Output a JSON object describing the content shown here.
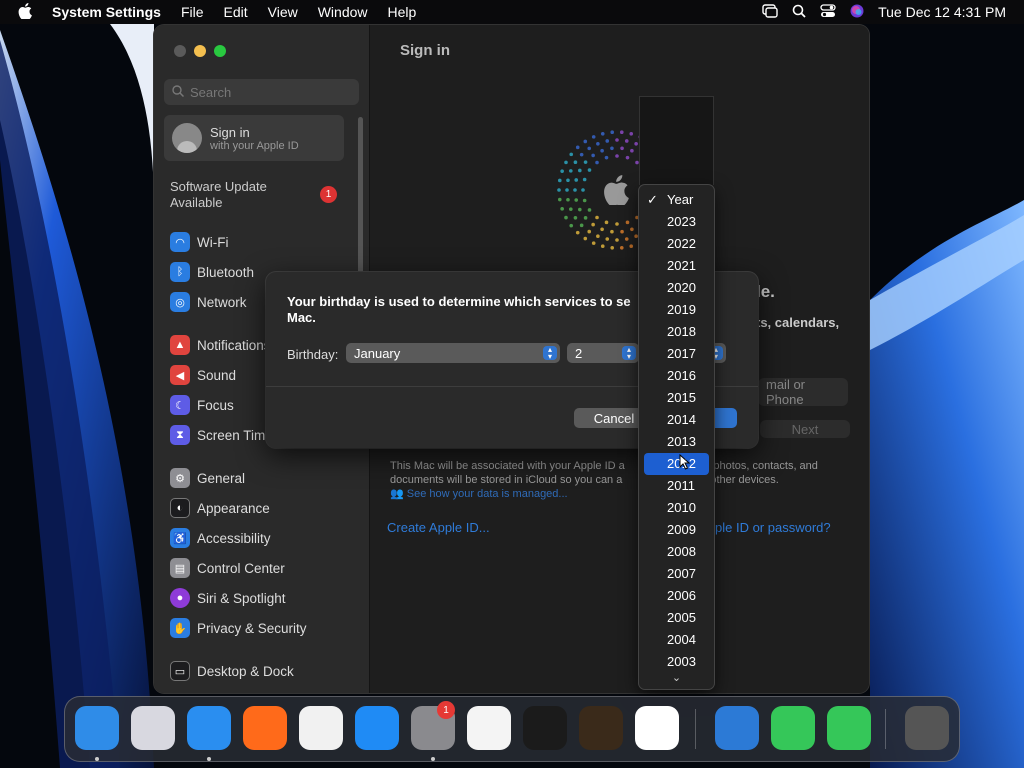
{
  "menubar": {
    "apple_icon": "apple-logo-icon",
    "app_name": "System Settings",
    "menus": [
      "File",
      "Edit",
      "View",
      "Window",
      "Help"
    ],
    "datetime": "Tue Dec 12  4:31 PM"
  },
  "sidebar": {
    "search_placeholder": "Search",
    "signin": {
      "title": "Sign in",
      "subtitle": "with your Apple ID"
    },
    "software_update": {
      "line1": "Software Update",
      "line2": "Available",
      "badge": "1"
    },
    "items": [
      {
        "label": "Wi-Fi",
        "icon": "wifi-icon",
        "color": "#2a7de1"
      },
      {
        "label": "Bluetooth",
        "icon": "bluetooth-icon",
        "color": "#2a7de1"
      },
      {
        "label": "Network",
        "icon": "globe-icon",
        "color": "#2a7de1"
      },
      {
        "label": "Notifications",
        "icon": "bell-icon",
        "color": "#e0443e"
      },
      {
        "label": "Sound",
        "icon": "speaker-icon",
        "color": "#e0443e"
      },
      {
        "label": "Focus",
        "icon": "moon-icon",
        "color": "#5e5ce6"
      },
      {
        "label": "Screen Time",
        "icon": "hourglass-icon",
        "color": "#5e5ce6"
      },
      {
        "label": "General",
        "icon": "gear-icon",
        "color": "#8e8e93"
      },
      {
        "label": "Appearance",
        "icon": "appearance-icon",
        "color": "#1c1c1e"
      },
      {
        "label": "Accessibility",
        "icon": "accessibility-icon",
        "color": "#2a7de1"
      },
      {
        "label": "Control Center",
        "icon": "control-center-icon",
        "color": "#8e8e93"
      },
      {
        "label": "Siri & Spotlight",
        "icon": "siri-icon",
        "color": "#8e3bd8"
      },
      {
        "label": "Privacy & Security",
        "icon": "hand-icon",
        "color": "#2a7de1"
      },
      {
        "label": "Desktop & Dock",
        "icon": "dock-icon",
        "color": "#1c1c1e"
      }
    ]
  },
  "main": {
    "title": "Sign in",
    "heading_fragment": "le.",
    "sub_fragment": "ts, calendars,",
    "email_placeholder": "mail or Phone",
    "next_label": "Next",
    "info_line1": "This Mac will be associated with your Apple ID a",
    "info_line1b": "s photos, contacts, and",
    "info_line2": "documents will be stored in iCloud so you can a",
    "info_line2b": "other devices.",
    "info_line3": "See how your data is managed...",
    "create_link": "Create Apple ID...",
    "forgot_link": "ple ID or password?"
  },
  "dialog": {
    "message": "Your birthday is used to determine which services to se Mac.",
    "birthday_label": "Birthday:",
    "month_value": "January",
    "day_value": "2",
    "cancel_label": "Cancel"
  },
  "year_menu": {
    "checked": "Year",
    "selected": "2012",
    "options": [
      "2023",
      "2022",
      "2021",
      "2020",
      "2019",
      "2018",
      "2017",
      "2016",
      "2015",
      "2014",
      "2013",
      "2012",
      "2011",
      "2010",
      "2009",
      "2008",
      "2007",
      "2006",
      "2005",
      "2004",
      "2003"
    ],
    "more_icon": "chevron-down-icon"
  },
  "dock": {
    "apps": [
      {
        "name": "Finder",
        "icon": "finder-icon",
        "color": "#2f8ce8",
        "running": true
      },
      {
        "name": "Launchpad",
        "icon": "launchpad-icon",
        "color": "#d8d8e0",
        "running": false
      },
      {
        "name": "Safari",
        "icon": "safari-icon",
        "color": "#2a8ef0",
        "running": true
      },
      {
        "name": "Firefox",
        "icon": "firefox-icon",
        "color": "#ff6a1a",
        "running": false
      },
      {
        "name": "Chrome",
        "icon": "chrome-icon",
        "color": "#f1f1f1",
        "running": false
      },
      {
        "name": "App Store",
        "icon": "appstore-icon",
        "color": "#1f8bf5",
        "running": false
      },
      {
        "name": "System Settings",
        "icon": "settings-icon",
        "color": "#8a8a8e",
        "running": true,
        "badge": "1"
      },
      {
        "name": "TextEdit",
        "icon": "textedit-icon",
        "color": "#f4f4f4",
        "running": false
      },
      {
        "name": "Terminal",
        "icon": "terminal-icon",
        "color": "#1b1b1b",
        "running": false
      },
      {
        "name": "GarageBand",
        "icon": "guitar-icon",
        "color": "#3a2a1a",
        "running": false
      },
      {
        "name": "VS Code",
        "icon": "vscode-icon",
        "color": "#ffffff",
        "running": false
      },
      {
        "name": "Weather",
        "icon": "weather-icon",
        "color": "#2c7ad6",
        "running": false
      },
      {
        "name": "FaceTime",
        "icon": "facetime-icon",
        "color": "#35c759",
        "running": false
      },
      {
        "name": "Messages",
        "icon": "messages-icon",
        "color": "#35c759",
        "running": false
      },
      {
        "name": "Trash",
        "icon": "trash-icon",
        "color": "#555555",
        "running": false
      }
    ]
  }
}
